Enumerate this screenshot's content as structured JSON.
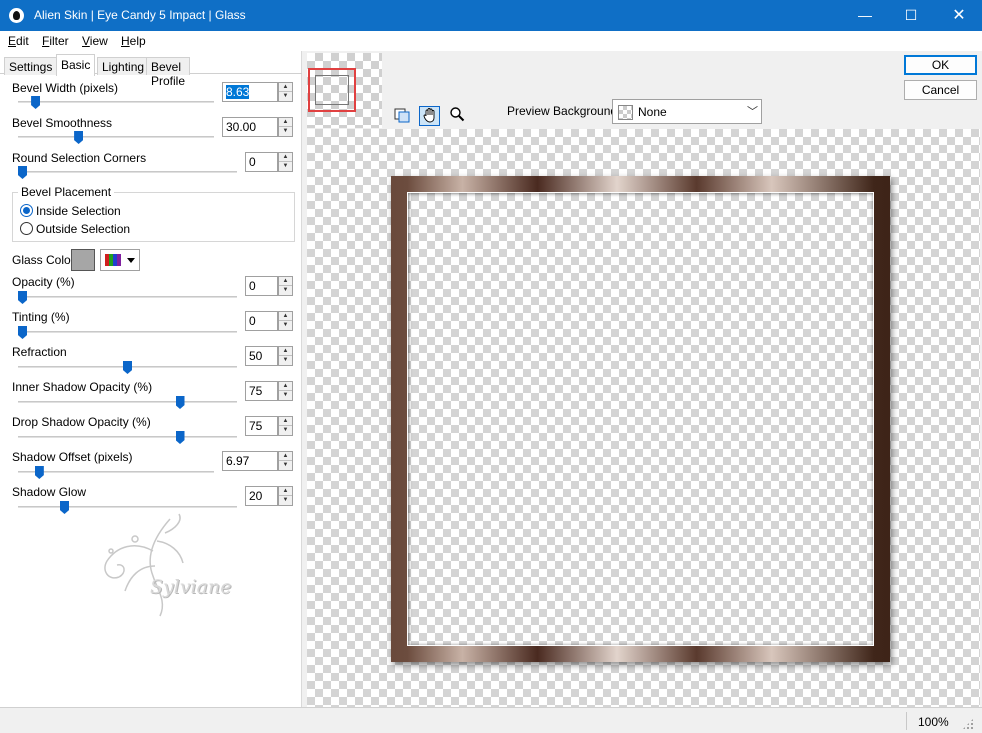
{
  "window": {
    "title": "Alien Skin | Eye Candy 5 Impact | Glass",
    "icon": "alien-head-icon",
    "controls": {
      "minimize": "—",
      "maximize": "☐",
      "close": "✕"
    }
  },
  "menu": [
    {
      "label": "Edit",
      "underline": "E",
      "rest": "dit"
    },
    {
      "label": "Filter",
      "underline": "F",
      "rest": "ilter"
    },
    {
      "label": "View",
      "underline": "V",
      "rest": "iew"
    },
    {
      "label": "Help",
      "underline": "H",
      "rest": "elp"
    }
  ],
  "tabs": {
    "settings": "Settings",
    "basic": "Basic",
    "lighting": "Lighting",
    "bevel_profile": "Bevel Profile",
    "active": "Basic"
  },
  "params": {
    "bevel_width": {
      "label": "Bevel Width (pixels)",
      "value": "8.63",
      "slider": 0.07
    },
    "bevel_smoothness": {
      "label": "Bevel Smoothness",
      "value": "30.00",
      "slider": 0.3
    },
    "round_corners": {
      "label": "Round Selection Corners",
      "value": "0",
      "slider": 0.0
    },
    "opacity": {
      "label": "Opacity (%)",
      "value": "0",
      "slider": 0.0
    },
    "tinting": {
      "label": "Tinting (%)",
      "value": "0",
      "slider": 0.0
    },
    "refraction": {
      "label": "Refraction",
      "value": "50",
      "slider": 0.5
    },
    "inner_shadow": {
      "label": "Inner Shadow Opacity (%)",
      "value": "75",
      "slider": 0.75
    },
    "drop_shadow": {
      "label": "Drop Shadow Opacity (%)",
      "value": "75",
      "slider": 0.75
    },
    "shadow_offset": {
      "label": "Shadow Offset (pixels)",
      "value": "6.97",
      "slider": 0.09
    },
    "shadow_glow": {
      "label": "Shadow Glow",
      "value": "20",
      "slider": 0.2
    }
  },
  "bevel_placement": {
    "title": "Bevel Placement",
    "inside": "Inside Selection",
    "outside": "Outside Selection",
    "selected": "Inside Selection"
  },
  "glass_color": {
    "label": "Glass Color",
    "color": "#a6a6a6"
  },
  "watermark": {
    "signature": "Sylviane"
  },
  "toolbar": {
    "navigate": "navigate-icon",
    "hand": "hand-icon",
    "zoom": "zoom-icon",
    "active": "hand"
  },
  "preview_background": {
    "label": "Preview Background:",
    "value": "None"
  },
  "buttons": {
    "ok": "OK",
    "cancel": "Cancel"
  },
  "status": {
    "zoom": "100%"
  },
  "colors": {
    "titlebar": "#0f6fc6",
    "accent": "#0b66c9"
  }
}
